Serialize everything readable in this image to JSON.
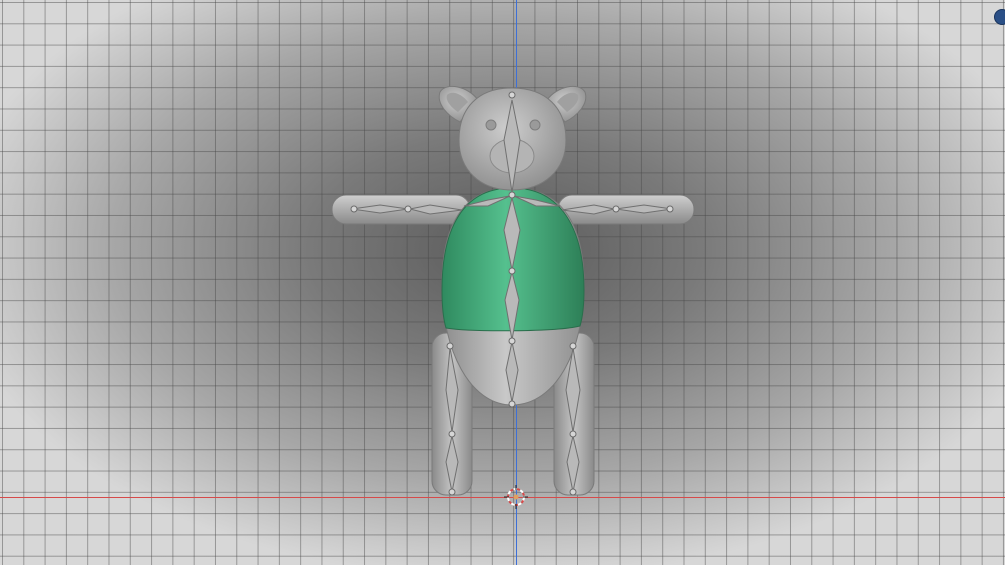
{
  "viewport": {
    "title": "",
    "accent_color": "#2a4f86",
    "axis_x_color": "#d64a4a",
    "axis_y_color": "#3d6fd6",
    "object": {
      "name": "",
      "body_color": "#aaaaaa",
      "vest_color": "#3fa57a"
    },
    "icons": [
      "3d-cursor-icon",
      "navigation-gizmo-icon"
    ]
  }
}
